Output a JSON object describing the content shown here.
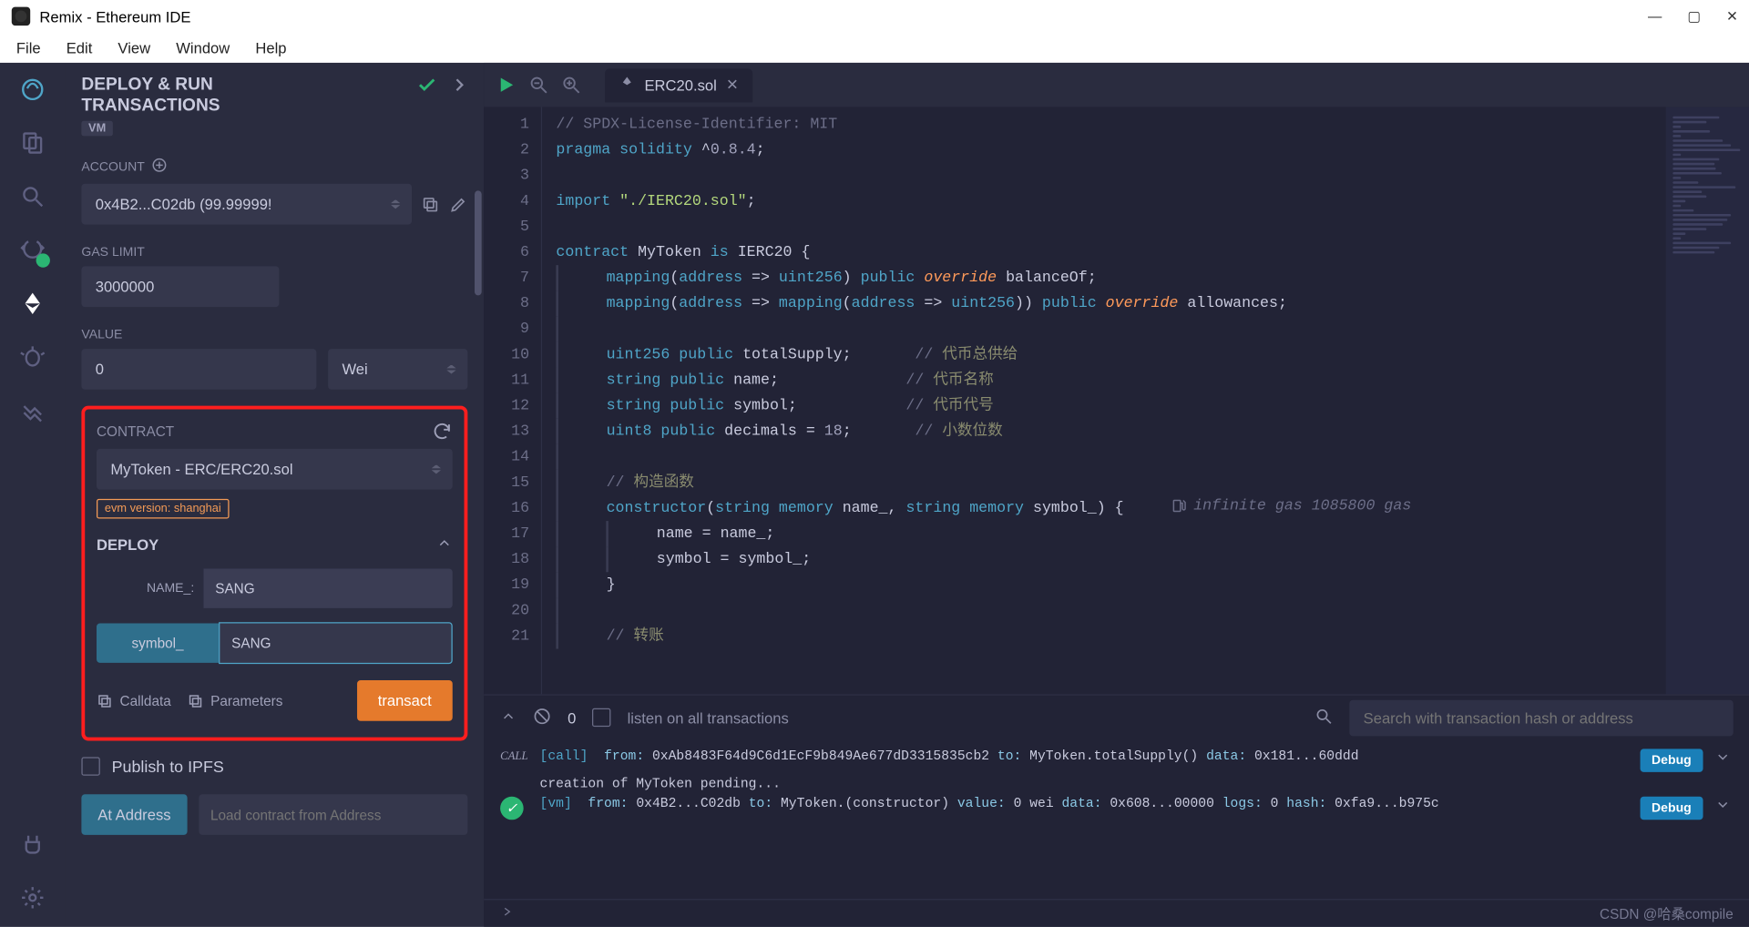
{
  "window": {
    "title": "Remix - Ethereum IDE"
  },
  "menubar": [
    "File",
    "Edit",
    "View",
    "Window",
    "Help"
  ],
  "win_controls": {
    "min": "—",
    "max": "▢",
    "close": "✕"
  },
  "iconbar": {
    "items": [
      "remix-logo",
      "files-icon",
      "search-icon",
      "compiler-icon",
      "deploy-icon",
      "debugger-icon",
      "overview-icon"
    ],
    "bottom": [
      "plugin-icon",
      "settings-icon"
    ]
  },
  "panel": {
    "title_line1": "DEPLOY & RUN",
    "title_line2": "TRANSACTIONS",
    "env_badge": "VM",
    "labels": {
      "account": "ACCOUNT",
      "gas": "GAS LIMIT",
      "value": "VALUE",
      "contract": "CONTRACT"
    },
    "account_value": "0x4B2...C02db (99.99999!",
    "gas_value": "3000000",
    "value_amount": "0",
    "value_unit": "Wei",
    "contract_selected": "MyToken - ERC/ERC20.sol",
    "evm_badge": "evm version: shanghai",
    "deploy_heading": "DEPLOY",
    "params": {
      "name_label": "NAME_:",
      "name_value": "SANG",
      "symbol_label": "symbol_",
      "symbol_value": "SANG"
    },
    "calldata": "Calldata",
    "params_btn": "Parameters",
    "transact": "transact",
    "publish": "Publish to IPFS",
    "ataddress": "At Address",
    "ataddress_ph": "Load contract from Address"
  },
  "editor": {
    "tab": {
      "file": "ERC20.sol"
    },
    "gas_hint": "infinite gas 1085800 gas",
    "lines": [
      {
        "n": 1,
        "html": "<span class='cmt'>// SPDX-License-Identifier: MIT</span>"
      },
      {
        "n": 2,
        "html": "<span class='kw'>pragma</span> <span class='kw'>solidity</span> <span class='op'>^</span><span class='cn'>0.8.4</span><span class='op'>;</span>"
      },
      {
        "n": 3,
        "html": ""
      },
      {
        "n": 4,
        "html": "<span class='kw'>import</span> <span class='str'>\"./IERC20.sol\"</span><span class='op'>;</span>"
      },
      {
        "n": 5,
        "html": ""
      },
      {
        "n": 6,
        "html": "<span class='kw'>contract</span> <span class='id'>MyToken</span> <span class='kw'>is</span> <span class='id'>IERC20</span> <span class='op'>{</span>"
      },
      {
        "n": 7,
        "html": "<span class='vline'></span>    <span class='kw'>mapping</span><span class='op'>(</span><span class='ty'>address</span> <span class='op'>=&gt;</span> <span class='ty'>uint256</span><span class='op'>)</span> <span class='kw'>public</span> <span class='kw2'>override</span> <span class='id'>balanceOf</span><span class='op'>;</span>"
      },
      {
        "n": 8,
        "html": "<span class='vline'></span>    <span class='kw'>mapping</span><span class='op'>(</span><span class='ty'>address</span> <span class='op'>=&gt;</span> <span class='kw'>mapping</span><span class='op'>(</span><span class='ty'>address</span> <span class='op'>=&gt;</span> <span class='ty'>uint256</span><span class='op'>))</span> <span class='kw'>public</span> <span class='kw2'>override</span> <span class='id'>allowances</span><span class='op'>;</span>"
      },
      {
        "n": 9,
        "html": "<span class='vline'></span>"
      },
      {
        "n": 10,
        "html": "<span class='vline'></span>    <span class='ty'>uint256</span> <span class='kw'>public</span> <span class='id'>totalSupply</span><span class='op'>;</span>       <span class='cmt'>// <span class='cjk'>代币总供给</span></span>"
      },
      {
        "n": 11,
        "html": "<span class='vline'></span>    <span class='ty'>string</span> <span class='kw'>public</span> <span class='id'>name</span><span class='op'>;</span>              <span class='cmt'>// <span class='cjk'>代币名称</span></span>"
      },
      {
        "n": 12,
        "html": "<span class='vline'></span>    <span class='ty'>string</span> <span class='kw'>public</span> <span class='id'>symbol</span><span class='op'>;</span>            <span class='cmt'>// <span class='cjk'>代币代号</span></span>"
      },
      {
        "n": 13,
        "html": "<span class='vline'></span>    <span class='ty'>uint8</span> <span class='kw'>public</span> <span class='id'>decimals</span> <span class='op'>=</span> <span class='cn'>18</span><span class='op'>;</span>       <span class='cmt'>// <span class='cjk'>小数位数</span></span>"
      },
      {
        "n": 14,
        "html": "<span class='vline'></span>"
      },
      {
        "n": 15,
        "html": "<span class='vline'></span>    <span class='cmt'>// <span class='cjk'>构造函数</span></span>"
      },
      {
        "n": 16,
        "html": "<span class='vline'></span>    <span class='kw'>constructor</span><span class='op'>(</span><span class='ty'>string</span> <span class='kw'>memory</span> <span class='id'>name_</span><span class='op'>,</span> <span class='ty'>string</span> <span class='kw'>memory</span> <span class='id'>symbol_</span><span class='op'>)</span> <span class='op'>{</span>"
      },
      {
        "n": 17,
        "html": "<span class='vline'></span>    <span class='vline'></span>    <span class='id'>name</span> <span class='op'>=</span> <span class='id'>name_</span><span class='op'>;</span>"
      },
      {
        "n": 18,
        "html": "<span class='vline'></span>    <span class='vline'></span>    <span class='id'>symbol</span> <span class='op'>=</span> <span class='id'>symbol_</span><span class='op'>;</span>"
      },
      {
        "n": 19,
        "html": "<span class='vline'></span>    <span class='op'>}</span>"
      },
      {
        "n": 20,
        "html": "<span class='vline'></span>"
      },
      {
        "n": 21,
        "html": "<span class='vline'></span>    <span class='cmt'>// <span class='cjk'>转账</span></span>"
      }
    ]
  },
  "terminal": {
    "count": "0",
    "listen": "listen on all transactions",
    "search_ph": "Search with transaction hash or address",
    "rows": [
      {
        "badge": "CALL",
        "text_html": "<span class='kw3'>[call]</span>  <span class='kw'>from:</span> 0xAb8483F64d9C6d1EcF9b849Ae677dD3315835cb2 <span class='kw'>to:</span> MyToken.totalSupply() <span class='kw'>data:</span> 0x181...60ddd",
        "debug": "Debug"
      },
      {
        "badge": "",
        "text_html": "creation of MyToken pending...",
        "debug": ""
      },
      {
        "badge": "OK",
        "text_html": "<span class='kw3'>[vm]</span>  <span class='kw'>from:</span> 0x4B2...C02db <span class='kw'>to:</span> MyToken.(constructor) <span class='kw'>value:</span> 0 wei <span class='kw'>data:</span> 0x608...00000 <span class='kw'>logs:</span> 0 <span class='kw'>hash:</span> 0xfa9...b975c",
        "debug": "Debug"
      }
    ],
    "watermark": "CSDN @哈桑compile"
  }
}
